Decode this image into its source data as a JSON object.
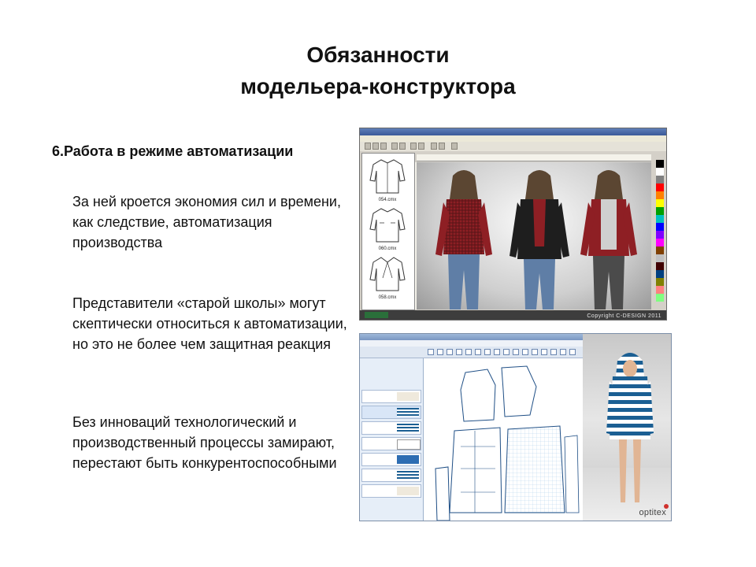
{
  "slide": {
    "title_line1": "Обязанности",
    "title_line2": "модельера-конструктора",
    "subtitle": "6.Работа в режиме автоматизации",
    "paragraphs": [
      "За ней кроется экономия сил и времени, как следствие, автоматизация производства",
      "Представители «старой школы» могут скептически относиться к автоматизации, но это не более чем защитная реакция",
      "Без инноваций технологический и производственный процессы замирают, перестают быть конкурентоспособными"
    ]
  },
  "screenshot_cad": {
    "thumb_captions": [
      "054.cmx",
      "060.cmx",
      "058.cmx"
    ],
    "copyright": "Copyright C-DESIGN 2011"
  },
  "screenshot_pattern": {
    "brand": "optitex"
  },
  "colors": {
    "plaid": "#8e1f24",
    "denim": "#5f7ea6",
    "stripe": "#1b5f93"
  }
}
